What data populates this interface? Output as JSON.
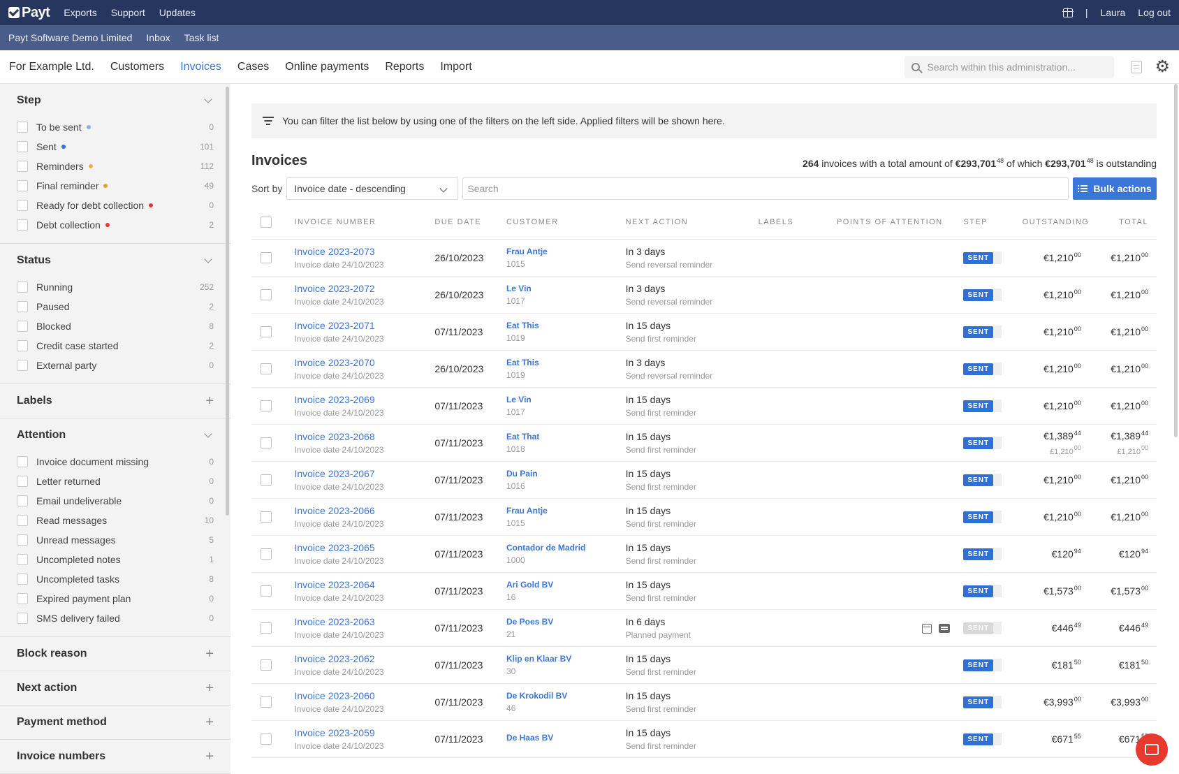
{
  "topbar": {
    "logo": "Payt",
    "links": [
      "Exports",
      "Support",
      "Updates"
    ],
    "separator": "|",
    "user": "Laura",
    "logout": "Log out"
  },
  "subbar": {
    "company": "Payt Software Demo Limited",
    "links": [
      "Inbox",
      "Task list"
    ]
  },
  "navbar": {
    "admin": "For Example Ltd.",
    "items": [
      "Customers",
      "Invoices",
      "Cases",
      "Online payments",
      "Reports",
      "Import"
    ],
    "active_index": 1,
    "search_placeholder": "Search within this administration..."
  },
  "sidebar": {
    "groups": [
      {
        "title": "Step",
        "toggle": "collapse",
        "items": [
          {
            "label": "To be sent",
            "count": "0",
            "dot": "#8fb0e8"
          },
          {
            "label": "Sent",
            "count": "101",
            "dot": "#2f6fd6"
          },
          {
            "label": "Reminders",
            "count": "112",
            "dot": "#e8b44a"
          },
          {
            "label": "Final reminder",
            "count": "49",
            "dot": "#e8a033"
          },
          {
            "label": "Ready for debt collection",
            "count": "0",
            "dot": "#e53935"
          },
          {
            "label": "Debt collection",
            "count": "2",
            "dot": "#e53935"
          }
        ]
      },
      {
        "title": "Status",
        "toggle": "collapse",
        "items": [
          {
            "label": "Running",
            "count": "252"
          },
          {
            "label": "Paused",
            "count": "2"
          },
          {
            "label": "Blocked",
            "count": "8"
          },
          {
            "label": "Credit case started",
            "count": "2"
          },
          {
            "label": "External party",
            "count": "0"
          }
        ]
      },
      {
        "title": "Labels",
        "toggle": "expand",
        "items": []
      },
      {
        "title": "Attention",
        "toggle": "collapse",
        "items": [
          {
            "label": "Invoice document missing",
            "count": "0"
          },
          {
            "label": "Letter returned",
            "count": "0"
          },
          {
            "label": "Email undeliverable",
            "count": "0"
          },
          {
            "label": "Read messages",
            "count": "10"
          },
          {
            "label": "Unread messages",
            "count": "5"
          },
          {
            "label": "Uncompleted notes",
            "count": "1"
          },
          {
            "label": "Uncompleted tasks",
            "count": "8"
          },
          {
            "label": "Expired payment plan",
            "count": "0"
          },
          {
            "label": "SMS delivery failed",
            "count": "0"
          }
        ]
      },
      {
        "title": "Block reason",
        "toggle": "expand",
        "items": []
      },
      {
        "title": "Next action",
        "toggle": "expand",
        "items": []
      },
      {
        "title": "Payment method",
        "toggle": "expand",
        "items": []
      },
      {
        "title": "Invoice numbers",
        "toggle": "expand",
        "items": []
      }
    ]
  },
  "main": {
    "info": "You can filter the list below by using one of the filters on the left side. Applied filters will be shown here.",
    "title": "Invoices",
    "summary": {
      "count": "264",
      "t1": "invoices with a total amount of",
      "total": "€293,701",
      "total_cents": "48",
      "t2": "of which",
      "outstanding": "€293,701",
      "outstanding_cents": "48",
      "t3": "is outstanding"
    },
    "sort_label": "Sort by",
    "sort_value": "Invoice date - descending",
    "search_placeholder": "Search",
    "bulk_label": "Bulk actions",
    "columns": [
      "INVOICE NUMBER",
      "DUE DATE",
      "CUSTOMER",
      "NEXT ACTION",
      "LABELS",
      "POINTS OF ATTENTION",
      "STEP",
      "OUTSTANDING",
      "TOTAL"
    ],
    "rows": [
      {
        "number": "Invoice 2023-2073",
        "date": "Invoice date 24/10/2023",
        "due": "26/10/2023",
        "customer": "Frau Antje",
        "cust_no": "1015",
        "next": "In 3 days",
        "next_sub": "Send reversal reminder",
        "step": "SENT",
        "out": "€1,210",
        "out_c": "00",
        "total": "€1,210",
        "total_c": "00"
      },
      {
        "number": "Invoice 2023-2072",
        "date": "Invoice date 24/10/2023",
        "due": "26/10/2023",
        "customer": "Le Vin",
        "cust_no": "1017",
        "next": "In 3 days",
        "next_sub": "Send reversal reminder",
        "step": "SENT",
        "out": "€1,210",
        "out_c": "00",
        "total": "€1,210",
        "total_c": "00"
      },
      {
        "number": "Invoice 2023-2071",
        "date": "Invoice date 24/10/2023",
        "due": "07/11/2023",
        "customer": "Eat This",
        "cust_no": "1019",
        "next": "In 15 days",
        "next_sub": "Send first reminder",
        "step": "SENT",
        "out": "€1,210",
        "out_c": "00",
        "total": "€1,210",
        "total_c": "00"
      },
      {
        "number": "Invoice 2023-2070",
        "date": "Invoice date 24/10/2023",
        "due": "26/10/2023",
        "customer": "Eat This",
        "cust_no": "1019",
        "next": "In 3 days",
        "next_sub": "Send reversal reminder",
        "step": "SENT",
        "out": "€1,210",
        "out_c": "00",
        "total": "€1,210",
        "total_c": "00"
      },
      {
        "number": "Invoice 2023-2069",
        "date": "Invoice date 24/10/2023",
        "due": "07/11/2023",
        "customer": "Le Vin",
        "cust_no": "1017",
        "next": "In 15 days",
        "next_sub": "Send first reminder",
        "step": "SENT",
        "out": "€1,210",
        "out_c": "00",
        "total": "€1,210",
        "total_c": "00"
      },
      {
        "number": "Invoice 2023-2068",
        "date": "Invoice date 24/10/2023",
        "due": "07/11/2023",
        "customer": "Eat That",
        "cust_no": "1018",
        "next": "In 15 days",
        "next_sub": "Send first reminder",
        "step": "SENT",
        "out": "€1,389",
        "out_c": "44",
        "out_sub": "£1,210",
        "out_sub_c": "00",
        "total": "€1,389",
        "total_c": "44",
        "total_sub": "£1,210",
        "total_sub_c": "00"
      },
      {
        "number": "Invoice 2023-2067",
        "date": "Invoice date 24/10/2023",
        "due": "07/11/2023",
        "customer": "Du Pain",
        "cust_no": "1016",
        "next": "In 15 days",
        "next_sub": "Send first reminder",
        "step": "SENT",
        "out": "€1,210",
        "out_c": "00",
        "total": "€1,210",
        "total_c": "00"
      },
      {
        "number": "Invoice 2023-2066",
        "date": "Invoice date 24/10/2023",
        "due": "07/11/2023",
        "customer": "Frau Antje",
        "cust_no": "1015",
        "next": "In 15 days",
        "next_sub": "Send first reminder",
        "step": "SENT",
        "out": "€1,210",
        "out_c": "00",
        "total": "€1,210",
        "total_c": "00"
      },
      {
        "number": "Invoice 2023-2065",
        "date": "Invoice date 24/10/2023",
        "due": "07/11/2023",
        "customer": "Contador de Madrid",
        "cust_no": "1000",
        "next": "In 15 days",
        "next_sub": "Send first reminder",
        "step": "SENT",
        "out": "€120",
        "out_c": "94",
        "total": "€120",
        "total_c": "94"
      },
      {
        "number": "Invoice 2023-2064",
        "date": "Invoice date 24/10/2023",
        "due": "07/11/2023",
        "customer": "Ari Gold BV",
        "cust_no": "16",
        "next": "In 15 days",
        "next_sub": "Send first reminder",
        "step": "SENT",
        "out": "€1,573",
        "out_c": "00",
        "total": "€1,573",
        "total_c": "00"
      },
      {
        "number": "Invoice 2023-2063",
        "date": "Invoice date 24/10/2023",
        "due": "07/11/2023",
        "customer": "De Poes BV",
        "cust_no": "21",
        "next": "In 6 days",
        "next_sub": "Planned payment",
        "step": "SENT",
        "step_muted": true,
        "attention": true,
        "out": "€446",
        "out_c": "49",
        "total": "€446",
        "total_c": "49"
      },
      {
        "number": "Invoice 2023-2062",
        "date": "Invoice date 24/10/2023",
        "due": "07/11/2023",
        "customer": "Klip en Klaar BV",
        "cust_no": "30",
        "next": "In 15 days",
        "next_sub": "Send first reminder",
        "step": "SENT",
        "out": "€181",
        "out_c": "50",
        "total": "€181",
        "total_c": "50"
      },
      {
        "number": "Invoice 2023-2060",
        "date": "Invoice date 24/10/2023",
        "due": "07/11/2023",
        "customer": "De Krokodil BV",
        "cust_no": "46",
        "next": "In 15 days",
        "next_sub": "Send first reminder",
        "step": "SENT",
        "out": "€3,993",
        "out_c": "00",
        "total": "€3,993",
        "total_c": "00"
      },
      {
        "number": "Invoice 2023-2059",
        "date": "Invoice date 24/10/2023",
        "due": "07/11/2023",
        "customer": "De Haas BV",
        "cust_no": "",
        "next": "In 15 days",
        "next_sub": "Send first reminder",
        "step": "SENT",
        "out": "€671",
        "out_c": "55",
        "total": "€671",
        "total_c": "55"
      }
    ]
  },
  "colors": {
    "topbar": "#26365f",
    "subbar": "#4a5c8a",
    "accent": "#3b77d9",
    "badge": "#2f6fd6",
    "chat": "#e8392e"
  }
}
